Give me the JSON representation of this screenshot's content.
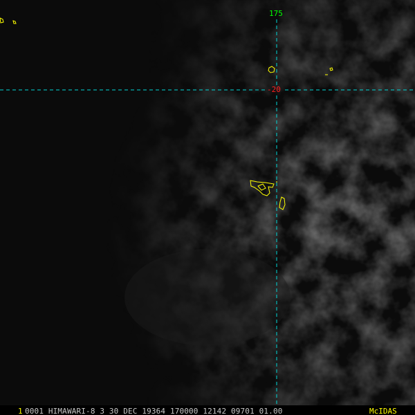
{
  "longitude_label": "175",
  "latitude_label": "-20",
  "status_bar": {
    "frame_number": "1",
    "text": "0001 HIMAWARI-8   3 30 DEC 19364 170000 12142 09701 01.00",
    "software": "McIDAS"
  },
  "colors": {
    "grid": "#00d8d8",
    "coastline": "#ffff00",
    "longitude_label": "#00ff00",
    "latitude_label": "#ff0000",
    "frame_number": "#ffff00",
    "status_text": "#c8c8c8",
    "software_label": "#ffff00"
  },
  "icons": [
    "coastline-outline",
    "graticule-line"
  ]
}
